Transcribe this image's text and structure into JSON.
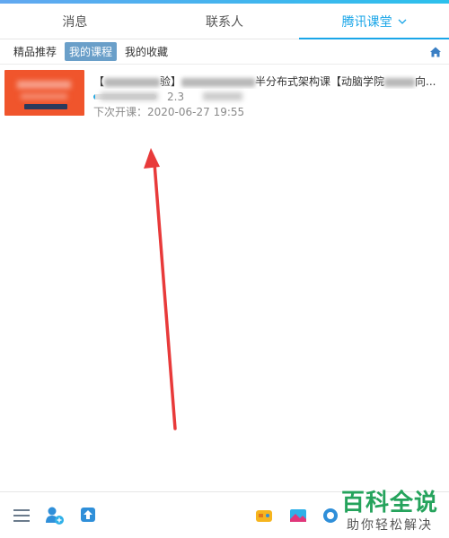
{
  "tabs": [
    {
      "label": "消息"
    },
    {
      "label": "联系人"
    },
    {
      "label": "腾讯课堂"
    }
  ],
  "subtabs": [
    {
      "label": "精品推荐"
    },
    {
      "label": "我的课程"
    },
    {
      "label": "我的收藏"
    }
  ],
  "course": {
    "title_prefix": "【",
    "title_mid1": "验】",
    "title_visible": "半分布式架构课【动脑学院",
    "title_tail": "向...",
    "progress_fraction": 0.03,
    "progress_text": "2.3",
    "next_class_label": "下次开课：",
    "next_class_time": "2020-06-27 19:55"
  },
  "watermark": {
    "main": "百科全说",
    "sub": "助你轻松解决"
  },
  "icons": [
    "chevron-down-icon",
    "home-icon",
    "menu-icon",
    "add-contact-icon",
    "upload-icon",
    "game-icon",
    "image-icon",
    "browser-icon"
  ],
  "colors": {
    "accent": "#1aa6e8",
    "subtab_active": "#6a9fc9",
    "thumb": "#f0552c",
    "arrow": "#e83a3a",
    "watermark": "#25a35c"
  }
}
